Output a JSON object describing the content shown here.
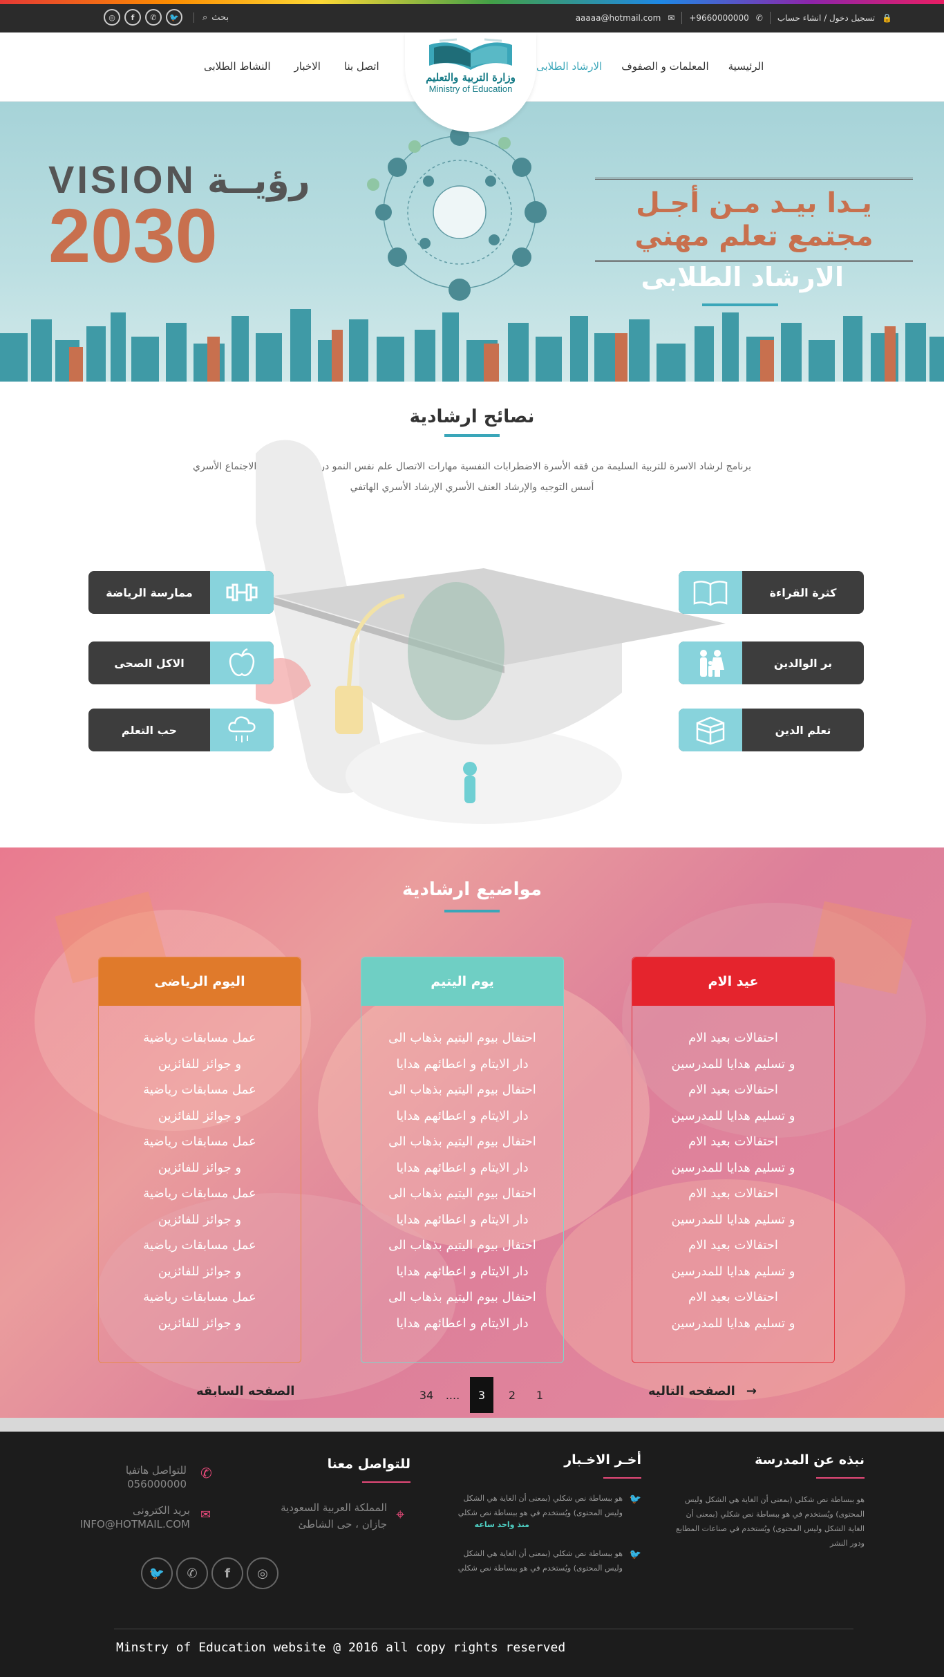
{
  "topbar": {
    "search_label": "بحث",
    "social": [
      "instagram-icon",
      "facebook-icon",
      "whatsapp-icon",
      "twitter-icon"
    ],
    "email": "aaaaa@hotmail.com",
    "phone": "+9660000000",
    "login_label": "تسجيل دخول / انشاء حساب"
  },
  "nav": {
    "items_right": [
      "الرئيسية",
      "المعلمات و الصفوف",
      "الارشاد الطلابى"
    ],
    "items_left": [
      "النشاط الطلابى",
      "الاخبار",
      "اتصل بنا"
    ],
    "active": "الارشاد الطلابى",
    "logo_ar": "وزارة التربية والتعليم",
    "logo_en": "Ministry of Education"
  },
  "hero": {
    "vision_word": "VISION",
    "vision_ar": "رؤيــة",
    "vision_year": "2030",
    "slogan_line1": "يـدا بيـد مـن أجـل",
    "slogan_line2": "مجتمع تعلم مهني",
    "title": "الارشاد الطلابى"
  },
  "tips": {
    "title": "نصائح ارشادية",
    "description": "برنامج لرشاد الاسرة للتربية السليمة من فقه الأسرة الاضطرابات النفسية مهارات الاتصال علم نفس النمو دراسة الحالة علم الاجتماع الأسري أسس التوجيه والإرشاد العنف الأسري الإرشاد الأسري الهاتفي",
    "left_items": [
      {
        "label": "ممارسة الرياضة",
        "icon": "dumbbell-icon"
      },
      {
        "label": "الاكل الصحى",
        "icon": "apple-icon"
      },
      {
        "label": "حب التعلم",
        "icon": "cloud-rain-icon"
      }
    ],
    "right_items": [
      {
        "label": "كثرة القراءة",
        "icon": "book-icon"
      },
      {
        "label": "بر الوالدين",
        "icon": "family-icon"
      },
      {
        "label": "تعلم الدين",
        "icon": "kaaba-icon"
      }
    ]
  },
  "topics": {
    "title": "مواضيع ارشادية",
    "cards": [
      {
        "title": "اليوم الرياضى",
        "color": "#e07a2b",
        "border": "#e78a4c",
        "lines": [
          "عمل مسابقات رياضية",
          "و جوائز للفائزين",
          "عمل مسابقات رياضية",
          "و جوائز للفائزين",
          "عمل مسابقات رياضية",
          "و جوائز للفائزين",
          "عمل مسابقات رياضية",
          "و جوائز للفائزين",
          "عمل مسابقات رياضية",
          "و جوائز للفائزين",
          "عمل مسابقات رياضية",
          "و جوائز للفائزين"
        ]
      },
      {
        "title": "يوم اليتيم",
        "color": "#6fcfc4",
        "border": "#7fd5cb",
        "lines": [
          "احتفال بيوم اليتيم بذهاب الى",
          "دار الايتام و اعطائهم هدايا",
          "احتفال بيوم اليتيم بذهاب الى",
          "دار الايتام و اعطائهم هدايا",
          "احتفال بيوم اليتيم بذهاب الى",
          "دار الايتام و اعطائهم هدايا",
          "احتفال بيوم اليتيم بذهاب الى",
          "دار الايتام و اعطائهم هدايا",
          "احتفال بيوم اليتيم بذهاب الى",
          "دار الايتام و اعطائهم هدايا",
          "احتفال بيوم اليتيم بذهاب الى",
          "دار الايتام و اعطائهم هدايا"
        ]
      },
      {
        "title": "عيد الام",
        "color": "#e5242d",
        "border": "#e5343d",
        "lines": [
          "احتفالات بعيد الام",
          "و تسليم هدايا للمدرسين",
          "احتفالات بعيد الام",
          "و تسليم هدايا للمدرسين",
          "احتفالات بعيد الام",
          "و تسليم هدايا للمدرسين",
          "احتفالات بعيد الام",
          "و تسليم هدايا للمدرسين",
          "احتفالات بعيد الام",
          "و تسليم هدايا للمدرسين",
          "احتفالات بعيد الام",
          "و تسليم هدايا للمدرسين"
        ]
      }
    ],
    "pager": {
      "prev_label": "الصفحه السابقه",
      "next_label": "الصفحه التاليه",
      "pages": [
        "34",
        "....",
        "3",
        "2",
        "1"
      ],
      "active_page": "3"
    }
  },
  "footer": {
    "about_title": "نبذه عن المدرسة",
    "about_text": "هو ببساطة نص شكلي (بمعنى أن الغاية هي الشكل وليس المحتوى) ويُستخدم في هو ببساطة نص شكلي (بمعنى أن الغاية الشكل وليس المحتوى) ويُستخدم في صناعات المطابع ودور النشر",
    "news_title": "أخـر الاخـبار",
    "news_items": [
      {
        "text": "هو ببساطة نص شكلي (بمعنى أن الغاية هي الشكل وليس المحتوى) ويُستخدم في هو ببساطة نص شكلي",
        "time": "منذ واحد ساعه"
      },
      {
        "text": "هو ببساطة نص شكلي (بمعنى أن الغاية هي الشكل وليس المحتوى) ويُستخدم في هو ببساطة نص شكلي",
        "time": ""
      }
    ],
    "contact_title": "للتواصل معنا",
    "address_line1": "المملكة العربية السعودية",
    "address_line2": "جازان ، حى الشاطئ",
    "phone_label": "للتواصل هاتفيا",
    "phone_value": "056000000",
    "email_label": "بريد الكترونى",
    "email_value": "INFO@HOTMAIL.COM",
    "social": [
      "twitter-icon",
      "whatsapp-icon",
      "facebook-icon",
      "instagram-icon"
    ],
    "copyright": "Minstry of Education website @ 2016  all copy rights reserved"
  },
  "colors": {
    "accent": "#3aa6b9",
    "dark": "#3d3d3d",
    "tip_icon_bg": "#88d3dc",
    "footer_bg": "#1c1c1c",
    "pink_accent": "#e84a7a"
  }
}
